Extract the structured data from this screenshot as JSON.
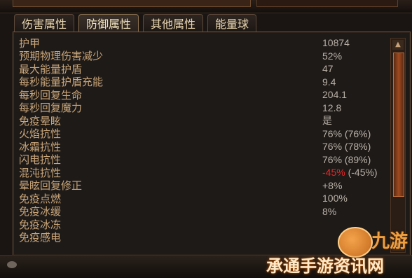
{
  "tabs": [
    {
      "label": "伤害属性",
      "active": false
    },
    {
      "label": "防御属性",
      "active": true
    },
    {
      "label": "其他属性",
      "active": false
    },
    {
      "label": "能量球",
      "active": false
    }
  ],
  "stats": [
    {
      "label": "护甲",
      "value": "10874"
    },
    {
      "label": "预期物理伤害减少",
      "value": "52%"
    },
    {
      "label": "最大能量护盾",
      "value": "47"
    },
    {
      "label": "每秒能量护盾充能",
      "value": "9.4"
    },
    {
      "label": "每秒回复生命",
      "value": "204.1"
    },
    {
      "label": "每秒回复魔力",
      "value": "12.8"
    },
    {
      "label": "免疫晕眩",
      "value": "是"
    },
    {
      "label": "火焰抗性",
      "value": "76% (76%)"
    },
    {
      "label": "冰霜抗性",
      "value": "76% (78%)"
    },
    {
      "label": "闪电抗性",
      "value": "76% (89%)"
    },
    {
      "label": "混沌抗性",
      "value_neg": "-45%",
      "value_rest": " (-45%)"
    },
    {
      "label": "晕眩回复修正",
      "value": "+8%"
    },
    {
      "label": "免疫点燃",
      "value": "100%"
    },
    {
      "label": "免疫冰缓",
      "value": "8%"
    },
    {
      "label": "免疫冰冻",
      "value": ""
    },
    {
      "label": "免疫感电",
      "value": ""
    }
  ],
  "watermark": {
    "top": "九游",
    "text": "承通手游资讯网"
  },
  "colors": {
    "label": "#c9a579",
    "value": "#b8b0a6",
    "negative": "#e02a2a",
    "accent": "#a04a20"
  }
}
